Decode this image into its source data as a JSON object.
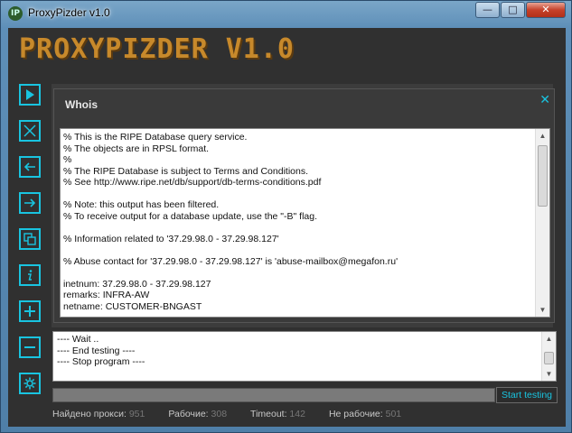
{
  "window": {
    "title": "ProxyPizder v1.0",
    "icon_text": "IP"
  },
  "logo": "PROXYPIZDER V1.0",
  "sidebar": [
    {
      "name": "play-icon"
    },
    {
      "name": "stop-icon"
    },
    {
      "name": "import-icon"
    },
    {
      "name": "export-icon"
    },
    {
      "name": "copy-icon"
    },
    {
      "name": "info-icon"
    },
    {
      "name": "plus-icon"
    },
    {
      "name": "minus-icon"
    },
    {
      "name": "gear-icon"
    }
  ],
  "whois": {
    "title": "Whois",
    "close": "✕",
    "lines": [
      "% This is the RIPE Database query service.",
      "% The objects are in RPSL format.",
      "%",
      "% The RIPE Database is subject to Terms and Conditions.",
      "% See http://www.ripe.net/db/support/db-terms-conditions.pdf",
      "",
      "% Note: this output has been filtered.",
      "% To receive output for a database update, use the \"-B\" flag.",
      "",
      "% Information related to '37.29.98.0 - 37.29.98.127'",
      "",
      "% Abuse contact for '37.29.98.0 - 37.29.98.127' is 'abuse-mailbox@megafon.ru'",
      "",
      "inetnum: 37.29.98.0 - 37.29.98.127",
      "remarks: INFRA-AW",
      "netname: CUSTOMER-BNGAST"
    ]
  },
  "log": {
    "lines": [
      "---- Wait ..",
      "---- End testing ----",
      "---- Stop program ----"
    ]
  },
  "progress": {
    "fraction": 0.0
  },
  "start_button": "Start testing",
  "stats": [
    {
      "label": "Найдено прокси:",
      "value": "951"
    },
    {
      "label": "Рабочие:",
      "value": "308"
    },
    {
      "label": "Timeout:",
      "value": "142"
    },
    {
      "label": "Не рабочие:",
      "value": "501"
    }
  ]
}
